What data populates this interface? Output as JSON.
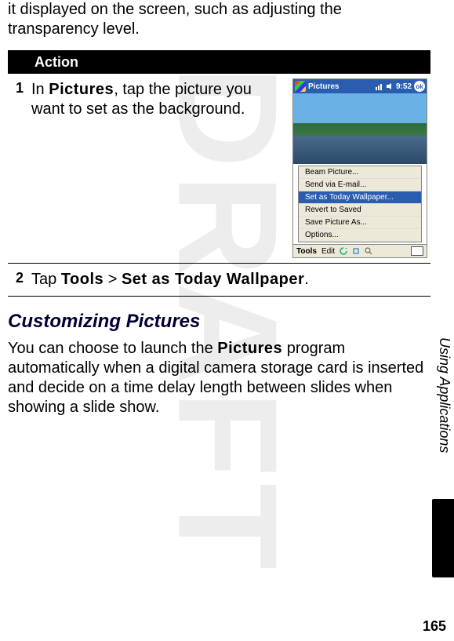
{
  "intro": "it displayed on the screen, such as adjusting the transparency level.",
  "watermark": "DRAFT",
  "action_header": "Action",
  "steps": [
    {
      "num": "1",
      "prefix": "In ",
      "bold1": "Pictures",
      "suffix": ", tap the picture you want to set as the background."
    },
    {
      "num": "2",
      "prefix": "Tap ",
      "bold1": "Tools",
      "mid": " > ",
      "bold2": "Set as Today Wallpaper",
      "suffix": "."
    }
  ],
  "device": {
    "title": "Pictures",
    "time": "9:52",
    "ok": "ok",
    "menu": [
      "Beam Picture...",
      "Send via E-mail...",
      "Set as Today Wallpaper...",
      "Revert to Saved",
      "Save Picture As...",
      "Options..."
    ],
    "toolbar_tools": "Tools",
    "toolbar_edit": "Edit"
  },
  "section_heading": "Customizing Pictures",
  "body": {
    "p1a": "You can choose to launch the ",
    "p1b": "Pictures",
    "p1c": " program automatically when a digital camera storage card is inserted and decide on a time delay length between slides when showing a slide show."
  },
  "side_label": "Using Applications",
  "page_number": "165"
}
